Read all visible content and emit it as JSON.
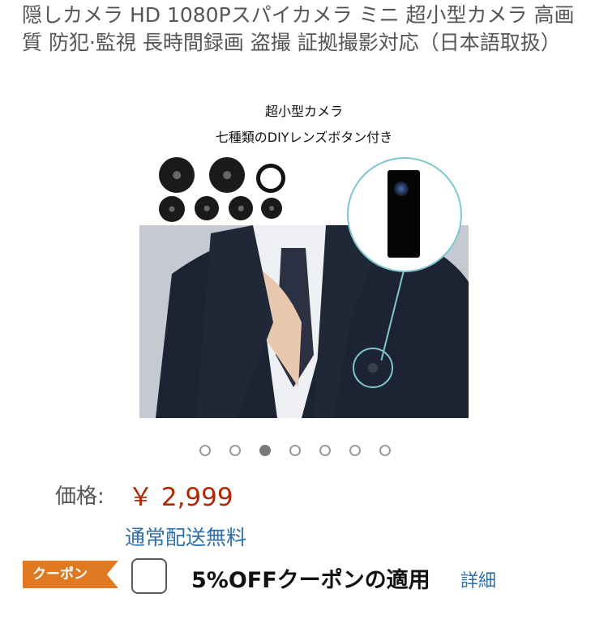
{
  "product": {
    "title": "隠しカメラ HD 1080Pスパイカメラ ミニ 超小型カメラ 高画質 防犯·監視 長時間録画 盗撮 証拠撮影対応（日本語取扱）",
    "image": {
      "caption_line1": "超小型カメラ",
      "caption_line2": "七種類のDIYレンズボタン付き",
      "gallery_count": 7,
      "active_index": 2
    }
  },
  "price": {
    "label": "価格:",
    "value": "￥ 2,999",
    "shipping": "通常配送無料"
  },
  "coupon": {
    "tag": "クーポン",
    "text": "5%OFFクーポンの適用",
    "detail_link": "詳細"
  },
  "colors": {
    "price": "#b12704",
    "link": "#2f6fa8",
    "coupon_tag": "#e07a22"
  }
}
